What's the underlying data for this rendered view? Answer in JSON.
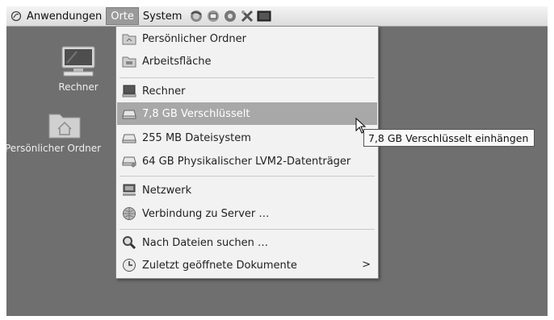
{
  "panel": {
    "applications_label": "Anwendungen",
    "places_label": "Orte",
    "system_label": "System",
    "launchers": [
      "firefox-icon",
      "mail-icon",
      "help-icon",
      "settings-icon",
      "terminal-icon"
    ]
  },
  "desktop": {
    "icons": [
      {
        "label": "Rechner",
        "icon": "computer-icon"
      },
      {
        "label": "Persönlicher Ordner",
        "icon": "home-folder-icon"
      }
    ]
  },
  "places_menu": {
    "items": [
      {
        "label": "Persönlicher Ordner",
        "icon": "home-folder-icon"
      },
      {
        "label": "Arbeitsfläche",
        "icon": "desktop-folder-icon"
      },
      {
        "label": "Rechner",
        "icon": "computer-icon"
      },
      {
        "label": "7,8 GB Verschlüsselt",
        "icon": "drive-icon",
        "highlighted": true
      },
      {
        "label": "255 MB Dateisystem",
        "icon": "drive-icon"
      },
      {
        "label": "64 GB Physikalischer LVM2-Datenträger",
        "icon": "drive-icon"
      },
      {
        "label": "Netzwerk",
        "icon": "network-icon"
      },
      {
        "label": "Verbindung zu Server …",
        "icon": "connect-server-icon"
      },
      {
        "label": "Nach Dateien suchen …",
        "icon": "search-icon"
      },
      {
        "label": "Zuletzt geöffnete Dokumente",
        "icon": "recent-documents-icon",
        "submenu_arrow": ">"
      }
    ]
  },
  "tooltip": {
    "text": "7,8 GB Verschlüsselt einhängen"
  },
  "colors": {
    "desktop": "#6f6f6f",
    "menu_background": "#f2f2f2",
    "highlight": "#a8a8a8",
    "active_menu": "#9a9a9a"
  }
}
